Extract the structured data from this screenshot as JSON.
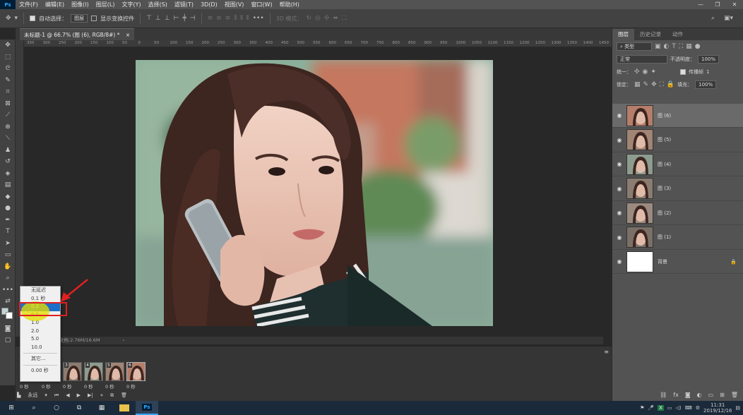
{
  "menubar": {
    "logo": "Ps",
    "items": [
      "文件(F)",
      "编辑(E)",
      "图像(I)",
      "图层(L)",
      "文字(Y)",
      "选择(S)",
      "滤镜(T)",
      "3D(D)",
      "视图(V)",
      "窗口(W)",
      "帮助(H)"
    ],
    "window_controls": [
      "—",
      "❐",
      "✕"
    ]
  },
  "options": {
    "auto_select_label": "自动选择：",
    "auto_select_value": "图层",
    "show_transform_label": "显示变换控件",
    "mode_3d_label": "3D 模式："
  },
  "document": {
    "tab_title": "未标题-1 @ 66.7% (图 (6), RGB/8#) *",
    "status": "文档:2.76M/16.6M"
  },
  "ruler_labels": [
    "350",
    "300",
    "250",
    "200",
    "150",
    "100",
    "50",
    "0",
    "50",
    "100",
    "150",
    "200",
    "250",
    "300",
    "350",
    "400",
    "450",
    "500",
    "550",
    "600",
    "650",
    "700",
    "750",
    "800",
    "850",
    "900",
    "950",
    "1000",
    "1050",
    "1100",
    "1150",
    "1200",
    "1250",
    "1300",
    "1350",
    "1400",
    "1450"
  ],
  "timeline": {
    "frames": [
      {
        "num": "3",
        "delay": "0 秒"
      },
      {
        "num": "4",
        "delay": "0 秒"
      },
      {
        "num": "5",
        "delay": "0 秒"
      },
      {
        "num": "6",
        "delay": "0 秒"
      }
    ],
    "first_delays": [
      "0 秒",
      "0 秒"
    ],
    "loop_label": "永远"
  },
  "delay_menu": {
    "items": [
      "无延迟",
      "0.1 秒",
      "0.2",
      "0.5",
      "1.0",
      "2.0",
      "5.0",
      "10.0"
    ],
    "other": "其它...",
    "current": "0.00 秒",
    "selected": "0.2"
  },
  "panel": {
    "tabs": [
      "图层",
      "历史记录",
      "动作"
    ],
    "filter_label": "类型",
    "blend_mode": "正常",
    "opacity_label": "不透明度：",
    "opacity_value": "100%",
    "unify_label": "统一：",
    "propagate_label": "传播帧",
    "propagate_value": "1",
    "lock_label": "锁定：",
    "fill_label": "填充：",
    "fill_value": "100%",
    "layers": [
      {
        "name": "图 (6)",
        "active": true
      },
      {
        "name": "图 (5)",
        "active": false
      },
      {
        "name": "图 (4)",
        "active": false
      },
      {
        "name": "图 (3)",
        "active": false
      },
      {
        "name": "图 (2)",
        "active": false
      },
      {
        "name": "图 (1)",
        "active": false
      },
      {
        "name": "背景",
        "active": false
      }
    ],
    "bottom_icons": [
      "link-icon",
      "fx",
      "mask-icon",
      "adjust-icon",
      "folder-icon",
      "new-layer-icon",
      "trash-icon"
    ]
  },
  "taskbar": {
    "ps_label": "Ps",
    "clock_time": "11:31",
    "clock_date": "2019/12/16"
  },
  "colors": {
    "accent_blue": "#1e6fc7",
    "highlight_red": "#e02020",
    "cursor_yellow": "#e6dc00",
    "brick_wall": "#c5775f"
  }
}
